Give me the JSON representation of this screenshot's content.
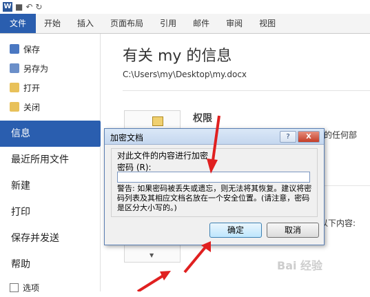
{
  "word_icon": "W",
  "colors": {
    "file_tab": "#2a5eaf",
    "active_item": "#2a5eaf",
    "arrow": "#e02020"
  },
  "quick_access": [
    {
      "icon": "save-icon",
      "glyph": "■"
    },
    {
      "icon": "undo-icon",
      "glyph": "↶"
    },
    {
      "icon": "redo-icon",
      "glyph": "↻"
    }
  ],
  "tabs": [
    "文件",
    "开始",
    "插入",
    "页面布局",
    "引用",
    "邮件",
    "审阅",
    "视图"
  ],
  "sidebar": {
    "small_items": [
      {
        "label": "保存",
        "icon": "save-icon"
      },
      {
        "label": "另存为",
        "icon": "save-as-icon"
      },
      {
        "label": "打开",
        "icon": "open-folder-icon"
      },
      {
        "label": "关闭",
        "icon": "close-folder-icon"
      }
    ],
    "big_items": [
      "信息",
      "最近所用文件",
      "新建",
      "打印",
      "保存并发送",
      "帮助"
    ],
    "options_label": "选项"
  },
  "main": {
    "title": "有关 my 的信息",
    "path": "C:\\Users\\my\\Desktop\\my.docx",
    "permission_title": "权限",
    "trunc_1": "档的任何部",
    "trunc_2": "以下内容:"
  },
  "dialog": {
    "title": "加密文档",
    "help": "?",
    "close": "X",
    "group_label": "对此文件的内容进行加密",
    "password_label": "密码 (R):",
    "password_value": "",
    "warning": "警告: 如果密码被丢失或遗忘，则无法将其恢复。建议将密码列表及其相应文档名放在一个安全位置。(请注意，密码是区分大小写的。)",
    "ok": "确定",
    "cancel": "取消"
  },
  "watermark": "Bai 经验"
}
